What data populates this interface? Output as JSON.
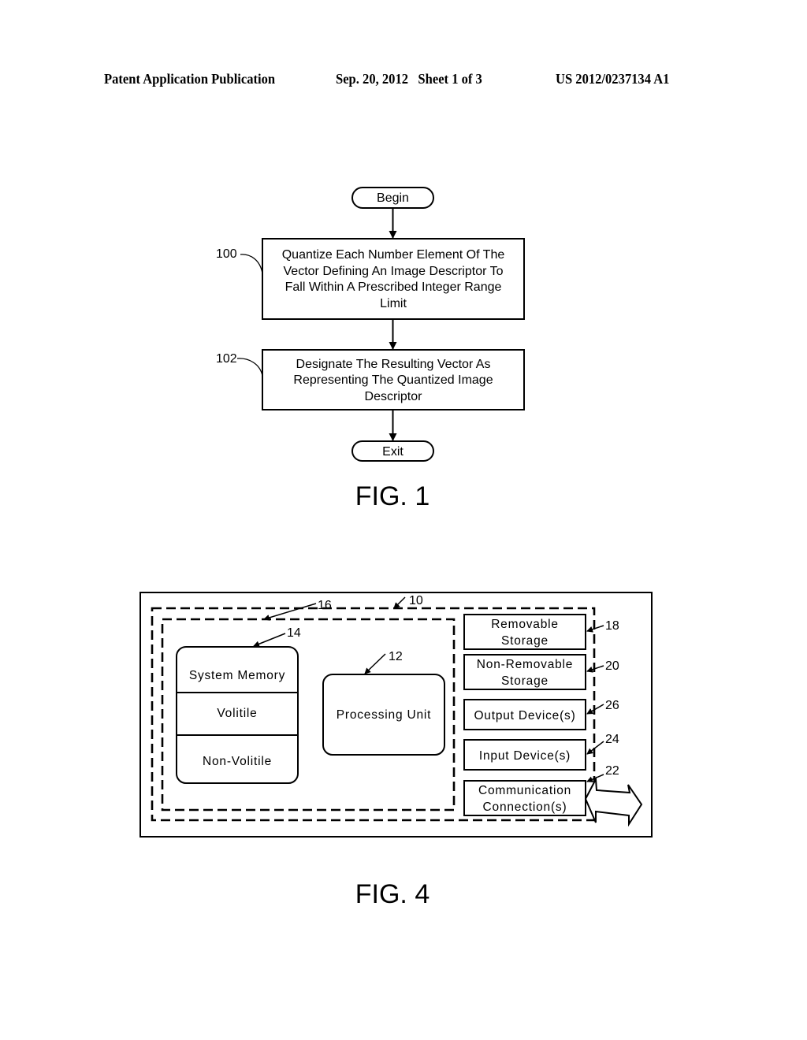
{
  "header": {
    "publication": "Patent Application Publication",
    "date_sheet": "Sep. 20, 2012   Sheet 1 of 3",
    "patent_number": "US 2012/0237134 A1"
  },
  "fig1": {
    "label": "FIG. 1",
    "begin": "Begin",
    "exit": "Exit",
    "steps": [
      {
        "ref": "100",
        "lines": [
          "Quantize Each Number Element Of The",
          "Vector Defining An Image Descriptor To",
          "Fall Within A Prescribed Integer Range",
          "Limit"
        ]
      },
      {
        "ref": "102",
        "lines": [
          "Designate The Resulting Vector As",
          "Representing The Quantized Image",
          "Descriptor"
        ]
      }
    ]
  },
  "fig4": {
    "label": "FIG. 4",
    "refs": {
      "device": "10",
      "basic_config": "16",
      "system_memory": "14",
      "processing_unit": "12",
      "removable_storage": "18",
      "non_removable_storage": "20",
      "output_devices": "26",
      "input_devices": "24",
      "communication": "22"
    },
    "system_memory": {
      "title": "System Memory",
      "volatile": "Volitile",
      "non_volatile": "Non-Volitile"
    },
    "processing_unit": "Processing Unit",
    "side_boxes": {
      "removable_storage": [
        "Removable",
        "Storage"
      ],
      "non_removable_storage": [
        "Non-Removable",
        "Storage"
      ],
      "output_devices": [
        "Output Device(s)"
      ],
      "input_devices": [
        "Input Device(s)"
      ],
      "communication": [
        "Communication",
        "Connection(s)"
      ]
    }
  }
}
